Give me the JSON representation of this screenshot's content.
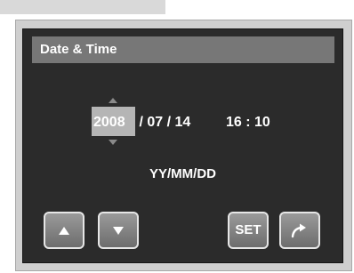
{
  "dialog": {
    "title": "Date & Time"
  },
  "datetime": {
    "year": "2008",
    "rest_of_date": " / 07 / 14",
    "time": "16 : 10",
    "selected_field": "year"
  },
  "format": {
    "label": "YY/MM/DD"
  },
  "buttons": {
    "up_icon": "triangle-up-icon",
    "down_icon": "triangle-down-icon",
    "set_label": "SET",
    "exit_icon": "curved-arrow-icon"
  },
  "colors": {
    "screen_background": "#2b2b2b",
    "title_bar": "#777777",
    "highlight": "#b5b5b5",
    "text": "#ffffff"
  }
}
